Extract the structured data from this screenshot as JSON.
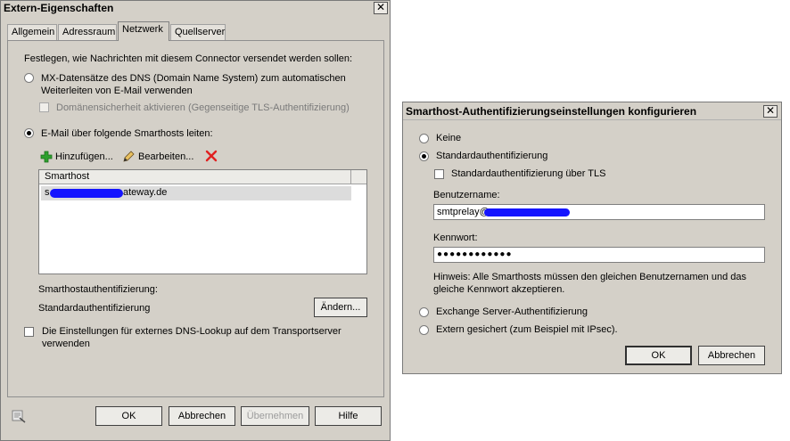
{
  "left_dialog": {
    "title": "Extern-Eigenschaften",
    "tabs": [
      "Allgemein",
      "Adressraum",
      "Netzwerk",
      "Quellserver"
    ],
    "active_tab": "Netzwerk",
    "intro": "Festlegen, wie Nachrichten mit diesem Connector versendet werden sollen:",
    "mx_option_line1": "MX-Datensätze des DNS (Domain Name System) zum automatischen",
    "mx_option_line2": "Weiterleiten von E-Mail verwenden",
    "domain_security": "Domänensicherheit aktivieren (Gegenseitige TLS-Authentifizierung)",
    "smarthost_option": "E-Mail über folgende Smarthosts leiten:",
    "toolbar": {
      "add": "Hinzufügen...",
      "edit": "Bearbeiten..."
    },
    "list_header": "Smarthost",
    "list_items": [
      {
        "prefix": "s",
        "suffix": "ateway.de"
      }
    ],
    "auth_label": "Smarthostauthentifizierung:",
    "auth_value": "Standardauthentifizierung",
    "change_button": "Ändern...",
    "dns_option_line1": "Die Einstellungen für externes DNS-Lookup auf dem Transportserver",
    "dns_option_line2": "verwenden",
    "buttons": {
      "ok": "OK",
      "cancel": "Abbrechen",
      "apply": "Übernehmen",
      "help": "Hilfe"
    }
  },
  "right_dialog": {
    "title": "Smarthost-Authentifizierungseinstellungen konfigurieren",
    "opt_none": "Keine",
    "opt_basic": "Standardauthentifizierung",
    "opt_basic_tls": "Standardauthentifizierung über TLS",
    "username_label": "Benutzername:",
    "username_value": "smtprelay@",
    "password_label": "Kennwort:",
    "password_value": "●●●●●●●●●●●●",
    "hint_line1": "Hinweis: Alle Smarthosts müssen den gleichen Benutzernamen und das",
    "hint_line2": "gleiche Kennwort akzeptieren.",
    "opt_exchange": "Exchange Server-Authentifizierung",
    "opt_external": "Extern gesichert (zum Beispiel mit IPsec).",
    "buttons": {
      "ok": "OK",
      "cancel": "Abbrechen"
    }
  },
  "colors": {
    "dialog_bg": "#d4d0c8",
    "redaction": "#1414ff",
    "delete_icon": "#e02020",
    "add_icon": "#2ea02e"
  }
}
